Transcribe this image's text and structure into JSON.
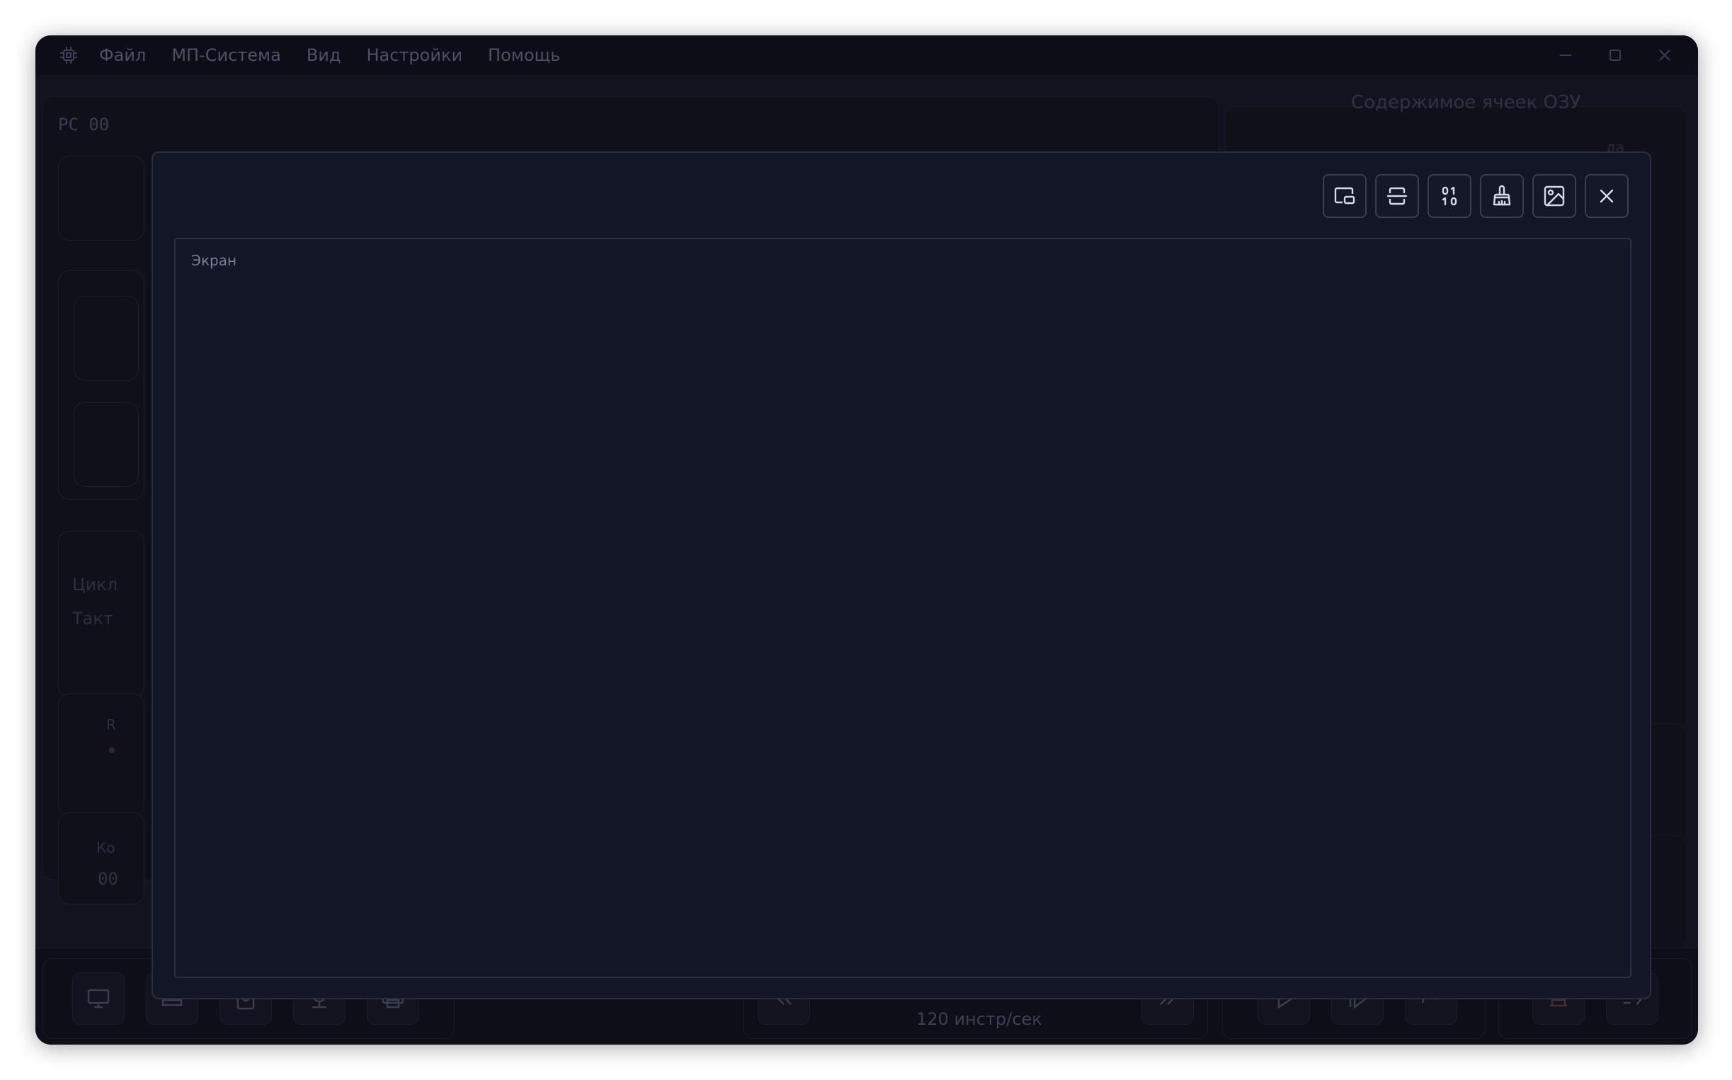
{
  "menu": {
    "items": [
      "Файл",
      "МП-Система",
      "Вид",
      "Настройки",
      "Помощь"
    ]
  },
  "background": {
    "pc_label": "PC 00",
    "ram_panel_title": "Содержимое ячеек ОЗУ",
    "ram_column_fragment": "да",
    "cycle_label": "Цикл",
    "tact_label": "Такт",
    "r_fragment": "R",
    "k_fragment": "Ко",
    "value_fragment": "00",
    "speed_label": "120 инстр/сек"
  },
  "dialog": {
    "screen_label": "Экран",
    "tools": [
      {
        "name": "window-mode",
        "icon": "picture-in-picture-icon"
      },
      {
        "name": "split-view",
        "icon": "split-horizontal-icon"
      },
      {
        "name": "binary-mode",
        "icon": "binary-icon"
      },
      {
        "name": "clear-screen",
        "icon": "brush-icon"
      },
      {
        "name": "save-image",
        "icon": "image-icon"
      },
      {
        "name": "close",
        "icon": "close-icon"
      }
    ]
  },
  "colors": {
    "dialog_bg": "#131626",
    "window_bg": "#12131f",
    "icon_stroke": "#d6d9ea",
    "dim_text": "#3a3d52"
  }
}
